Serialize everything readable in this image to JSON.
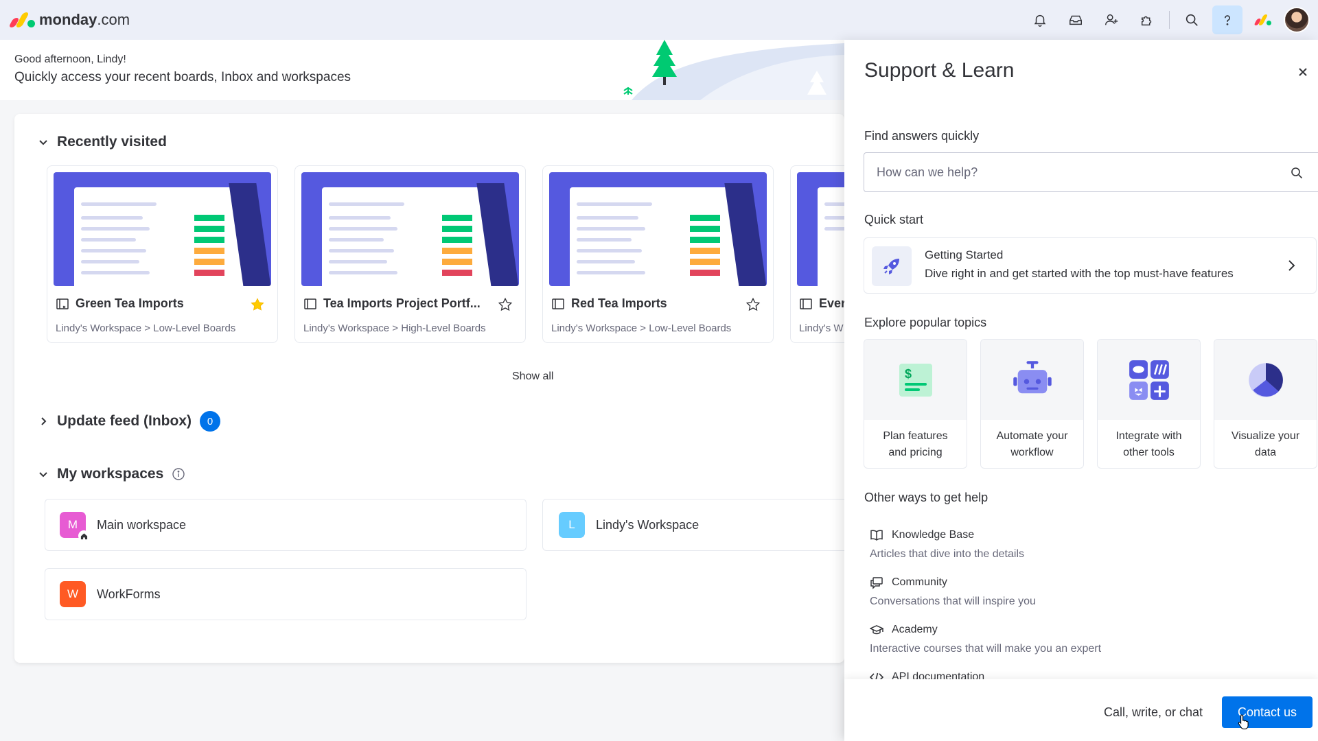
{
  "app": {
    "logo_word": "monday",
    "logo_suffix": ".com",
    "brand_colors": [
      "#ff3d57",
      "#ffcb00",
      "#00ca72"
    ]
  },
  "topbar": {
    "icons": [
      "bell-icon",
      "inbox-icon",
      "invite-members-icon",
      "apps-icon",
      "search-icon",
      "help-icon"
    ]
  },
  "banner": {
    "greeting": "Good afternoon, Lindy!",
    "subtitle": "Quickly access your recent boards, Inbox and workspaces"
  },
  "recent": {
    "title": "Recently visited",
    "boards": [
      {
        "title": "Green Tea Imports",
        "path": "Lindy's Workspace > Low-Level Boards",
        "starred": true
      },
      {
        "title": "Tea Imports Project Portf...",
        "path": "Lindy's Workspace > High-Level Boards",
        "starred": false
      },
      {
        "title": "Red Tea Imports",
        "path": "Lindy's Workspace > Low-Level Boards",
        "starred": false
      },
      {
        "title": "Ever",
        "path": "Lindy's W",
        "starred": false
      }
    ],
    "show_all": "Show all"
  },
  "update_feed": {
    "title": "Update feed (Inbox)",
    "count": "0"
  },
  "workspaces": {
    "title": "My workspaces",
    "items": [
      {
        "letter": "M",
        "name": "Main workspace",
        "color": "#e75bd3"
      },
      {
        "letter": "L",
        "name": "Lindy's Workspace",
        "color": "#66ccff"
      },
      {
        "letter": "W",
        "name": "WorkForms",
        "color": "#ff5a24"
      }
    ]
  },
  "panel": {
    "title": "Support & Learn",
    "find_label": "Find answers quickly",
    "search_placeholder": "How can we help?",
    "quick_start_label": "Quick start",
    "quick": {
      "title": "Getting Started",
      "desc": "Dive right in and get started with the top must-have features"
    },
    "topics_label": "Explore popular topics",
    "topics": [
      {
        "line1": "Plan features",
        "line2": "and pricing"
      },
      {
        "line1": "Automate your",
        "line2": "workflow"
      },
      {
        "line1": "Integrate with",
        "line2": "other tools"
      },
      {
        "line1": "Visualize your",
        "line2": "data"
      }
    ],
    "other_label": "Other ways to get help",
    "help": [
      {
        "title": "Knowledge Base",
        "desc": "Articles that dive into the details"
      },
      {
        "title": "Community",
        "desc": "Conversations that will inspire you"
      },
      {
        "title": "Academy",
        "desc": "Interactive courses that will make you an expert"
      },
      {
        "title": "API documentation",
        "desc": ""
      }
    ],
    "footer_text": "Call, write, or chat",
    "contact_label": "Contact us",
    "accent": "#0073ea"
  }
}
